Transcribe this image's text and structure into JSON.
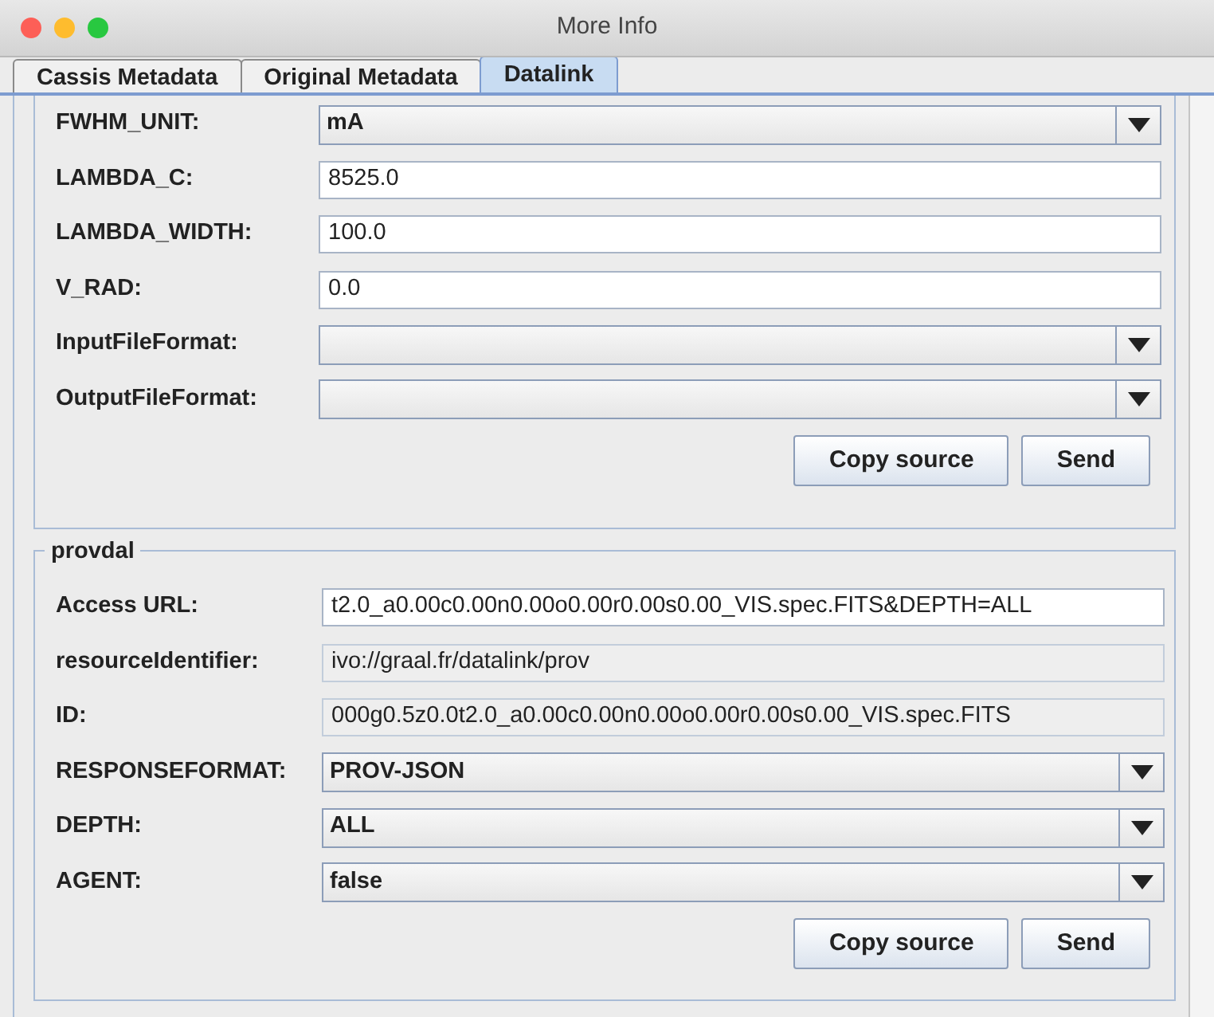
{
  "window": {
    "title": "More Info"
  },
  "tabs": [
    {
      "label": "Cassis Metadata",
      "selected": false
    },
    {
      "label": "Original Metadata",
      "selected": false
    },
    {
      "label": "Datalink",
      "selected": true
    }
  ],
  "sections": [
    {
      "fields": [
        {
          "label": "FWHM_UNIT:",
          "kind": "select",
          "value": "mA"
        },
        {
          "label": "LAMBDA_C:",
          "kind": "text",
          "value": "8525.0"
        },
        {
          "label": "LAMBDA_WIDTH:",
          "kind": "text",
          "value": "100.0"
        },
        {
          "label": "V_RAD:",
          "kind": "text",
          "value": "0.0"
        },
        {
          "label": "InputFileFormat:",
          "kind": "select"
        },
        {
          "label": "OutputFileFormat:",
          "kind": "select"
        }
      ],
      "buttons": [
        "Copy source",
        "Send"
      ]
    },
    {
      "title": "provdal",
      "fields": [
        {
          "label": "Access URL:",
          "kind": "text",
          "value": "t2.0_a0.00c0.00n0.00o0.00r0.00s0.00_VIS.spec.FITS&DEPTH=ALL"
        },
        {
          "label": "resourceIdentifier:",
          "kind": "readonly",
          "value": "ivo://graal.fr/datalink/prov"
        },
        {
          "label": "ID:",
          "kind": "readonly",
          "value": "000g0.5z0.0t2.0_a0.00c0.00n0.00o0.00r0.00s0.00_VIS.spec.FITS"
        },
        {
          "label": "RESPONSEFORMAT:",
          "kind": "select",
          "value": "PROV-JSON"
        },
        {
          "label": "DEPTH:",
          "kind": "select",
          "value": "ALL"
        },
        {
          "label": "AGENT:",
          "kind": "select",
          "value": "false"
        }
      ],
      "buttons": [
        "Copy source",
        "Send"
      ]
    }
  ]
}
